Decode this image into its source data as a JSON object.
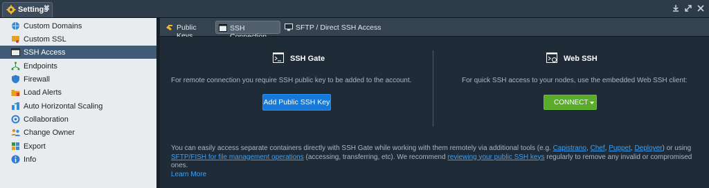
{
  "window": {
    "tab_title": "Settings",
    "close_label": "✖",
    "controls": [
      "download-icon",
      "expand-icon",
      "close-window-icon"
    ]
  },
  "sidebar": {
    "items": [
      {
        "label": "Custom Domains",
        "icon": "globe-icon"
      },
      {
        "label": "Custom SSL",
        "icon": "certificate-icon"
      },
      {
        "label": "SSH Access",
        "icon": "terminal-icon",
        "active": true
      },
      {
        "label": "Endpoints",
        "icon": "endpoints-icon"
      },
      {
        "label": "Firewall",
        "icon": "shield-icon"
      },
      {
        "label": "Load Alerts",
        "icon": "alert-folder-icon"
      },
      {
        "label": "Auto Horizontal Scaling",
        "icon": "scaling-icon"
      },
      {
        "label": "Collaboration",
        "icon": "collaboration-icon"
      },
      {
        "label": "Change Owner",
        "icon": "change-owner-icon"
      },
      {
        "label": "Export",
        "icon": "export-icon"
      },
      {
        "label": "Info",
        "icon": "info-icon"
      }
    ]
  },
  "tabs": [
    {
      "label": "Public Keys",
      "icon": "key-icon"
    },
    {
      "label": "SSH Connection",
      "icon": "terminal-icon",
      "active": true
    },
    {
      "label": "SFTP / Direct SSH Access",
      "icon": "monitor-icon"
    }
  ],
  "ssh_gate": {
    "title": "SSH Gate",
    "description": "For remote connection you require SSH public key to be added to the account.",
    "button": "Add Public SSH Key"
  },
  "web_ssh": {
    "title": "Web SSH",
    "description": "For quick SSH access to your nodes, use the embedded Web SSH client:",
    "button": "CONNECT"
  },
  "info": {
    "text1": "You can easily access separate containers directly with SSH Gate while working with them remotely via additional tools (e.g.",
    "capistrano": "Capistrano",
    "chef": "Chef",
    "puppet": "Puppet",
    "deployer": "Deployer",
    "text2": ") or using",
    "sftp_link": "SFTP/FISH for file management operations",
    "text3": "(accessing, transferring, etc). We recommend",
    "review_link": "reviewing your public SSH keys",
    "text4": "regularly to remove any invalid or compromised ones.",
    "learn_more": "Learn More"
  },
  "colors": {
    "accent_blue": "#1479d8",
    "connect_green": "#5aac2a",
    "link": "#3ea0f5",
    "active_row": "#3f5b76"
  }
}
